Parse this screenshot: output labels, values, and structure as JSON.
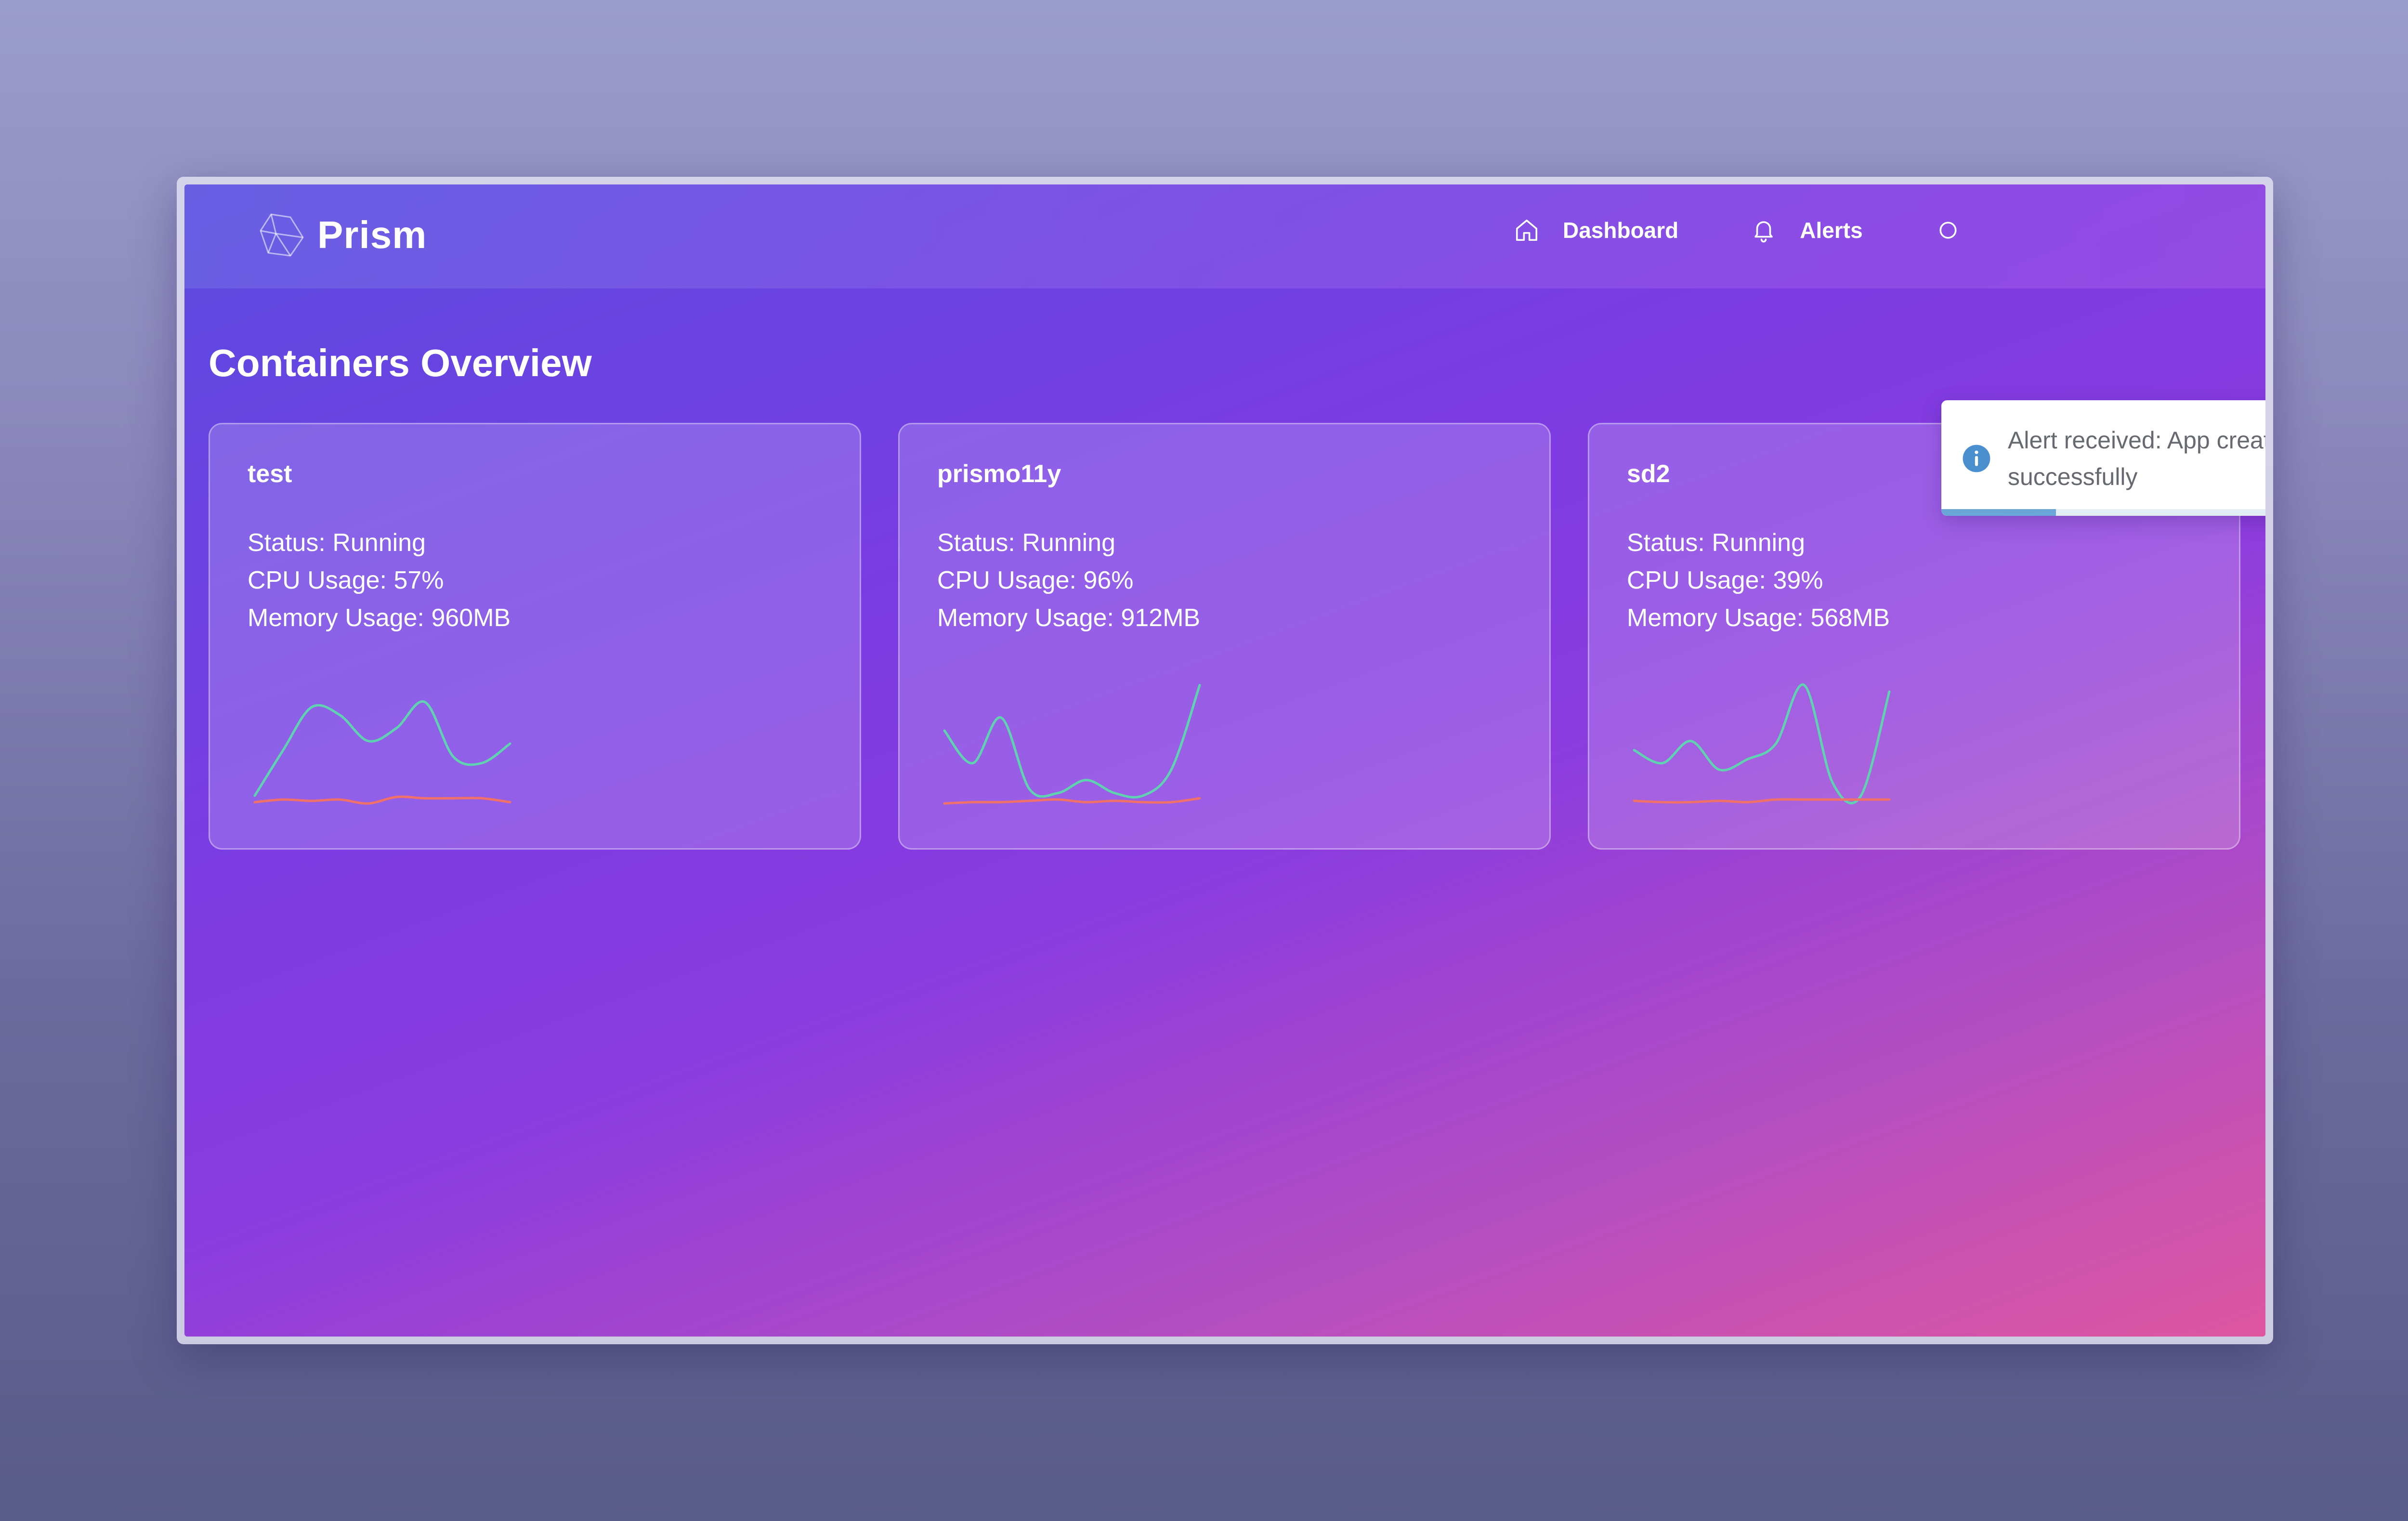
{
  "app": {
    "brand_name": "Prism",
    "logo_icon": "prism-logo-icon"
  },
  "nav": {
    "items": [
      {
        "label": "Dashboard",
        "icon": "home-icon"
      },
      {
        "label": "Alerts",
        "icon": "bell-icon"
      }
    ]
  },
  "page": {
    "title": "Containers Overview"
  },
  "containers": [
    {
      "name": "test",
      "status": "Status: Running",
      "cpu": "CPU Usage: 57%",
      "memory": "Memory Usage: 960MB"
    },
    {
      "name": "prismo11y",
      "status": "Status: Running",
      "cpu": "CPU Usage: 96%",
      "memory": "Memory Usage: 912MB"
    },
    {
      "name": "sd2",
      "status": "Status: Running",
      "cpu": "CPU Usage: 39%",
      "memory": "Memory Usage: 568MB"
    }
  ],
  "toast": {
    "message": "Alert received: App created successfully",
    "icon": "info-icon",
    "close_icon": "close-icon",
    "progress": 0.24
  },
  "colors": {
    "cpu_line": "#5fd3b0",
    "memory_line": "#f0706a",
    "info": "#4a8fd0"
  },
  "chart_data": [
    {
      "type": "line",
      "container": "test",
      "series": [
        {
          "values": [
            10,
            45,
            78,
            72,
            52,
            62,
            82,
            40,
            35,
            50
          ]
        },
        {
          "values": [
            5,
            7,
            6,
            7,
            4,
            9,
            8,
            8,
            8,
            5
          ]
        }
      ]
    },
    {
      "type": "line",
      "container": "prismo11y",
      "series": [
        {
          "values": [
            60,
            35,
            70,
            15,
            12,
            22,
            12,
            10,
            30,
            95
          ]
        },
        {
          "values": [
            4,
            5,
            5,
            6,
            7,
            5,
            6,
            5,
            5,
            8
          ]
        }
      ]
    },
    {
      "type": "line",
      "container": "sd2",
      "series": [
        {
          "values": [
            45,
            35,
            52,
            30,
            38,
            50,
            95,
            20,
            10,
            90
          ]
        },
        {
          "values": [
            6,
            5,
            5,
            6,
            5,
            7,
            7,
            7,
            7,
            7
          ]
        }
      ]
    }
  ]
}
